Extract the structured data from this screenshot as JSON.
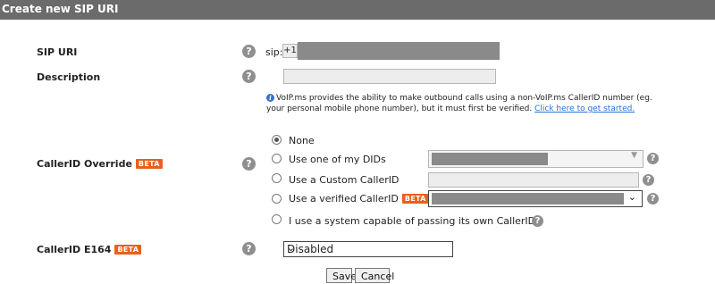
{
  "header": {
    "title": "Create new SIP URI"
  },
  "sip_uri": {
    "label": "SIP URI",
    "prefix": "sip:",
    "value": "+1"
  },
  "description": {
    "label": "Description",
    "value": ""
  },
  "info": {
    "text": "VoIP.ms provides the ability to make outbound calls using a non-VoIP.ms CallerID number (eg. your personal mobile phone number), but it must first be verified.",
    "link": "Click here to get started."
  },
  "callerid_override": {
    "label": "CallerID Override",
    "badge": "BETA",
    "options": {
      "none": "None",
      "dids": "Use one of my DIDs",
      "custom": "Use a Custom CallerID",
      "verified": "Use a verified CallerID",
      "system": "I use a system capable of passing its own CallerID"
    },
    "selected": "none"
  },
  "callerid_e164": {
    "label": "CallerID E164",
    "badge": "BETA",
    "selected": "Disabled"
  },
  "buttons": {
    "save": "Save",
    "cancel": "Cancel"
  },
  "icons": {
    "help": "question-mark-icon",
    "info": "info-icon",
    "dropdown": "chevron-down-icon"
  },
  "colors": {
    "titlebar": "#6b6b6b",
    "beta": "#e8601c",
    "link": "#2a6fd6",
    "help": "#8f8f8f"
  }
}
